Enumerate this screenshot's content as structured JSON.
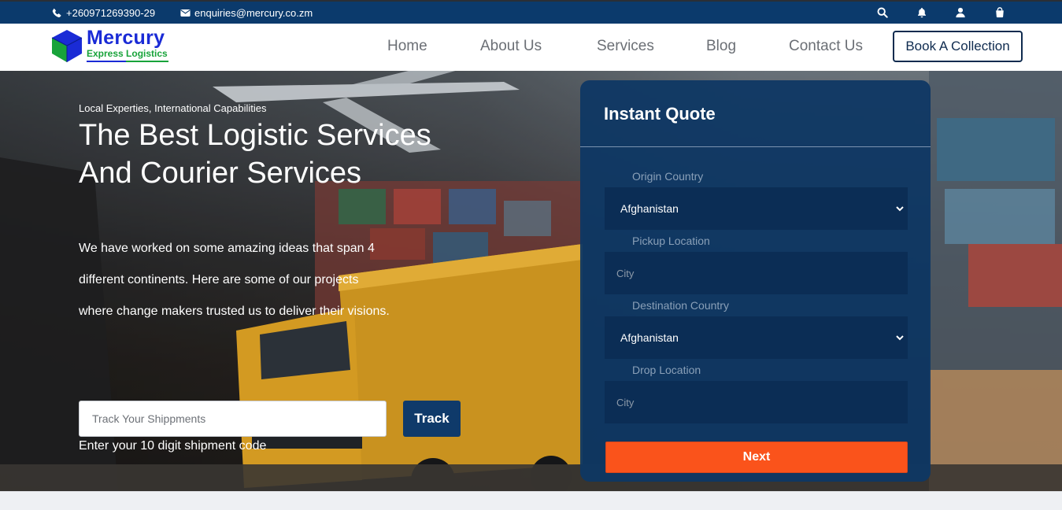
{
  "topbar": {
    "phone": "+260971269390-29",
    "email": "enquiries@mercury.co.zm",
    "icons": [
      "phone-icon",
      "envelope-icon",
      "search-icon",
      "bell-icon",
      "user-icon",
      "shopping-bag-icon"
    ]
  },
  "logo": {
    "name": "Mercury",
    "tagline": "Express Logistics"
  },
  "nav": {
    "items": [
      "Home",
      "About Us",
      "Services",
      "Blog",
      "Contact Us"
    ],
    "cta": "Book A Collection"
  },
  "hero": {
    "eyebrow": "Local Experties, International Capabilities",
    "headline": "The Best Logistic Services And Courier Services",
    "paragraph": "We have worked on some amazing ideas that span 4 different continents. Here are some of our projects where change makers trusted us to deliver their visions.",
    "track_placeholder": "Track Your Shippments",
    "track_button": "Track",
    "track_hint": "Enter your 10 digit shipment code"
  },
  "quote": {
    "title": "Instant Quote",
    "origin_label": "Origin Country",
    "origin_value": "Afghanistan",
    "pickup_label": "Pickup Location",
    "pickup_placeholder": "City",
    "destination_label": "Destination Country",
    "destination_value": "Afghanistan",
    "drop_label": "Drop Location",
    "drop_placeholder": "City",
    "next_button": "Next"
  },
  "colors": {
    "topbar": "#0b3a6c",
    "brand_blue": "#1a2bd6",
    "brand_green": "#18a33a",
    "panel": "#0e3764",
    "cta_orange": "#fa531b"
  }
}
